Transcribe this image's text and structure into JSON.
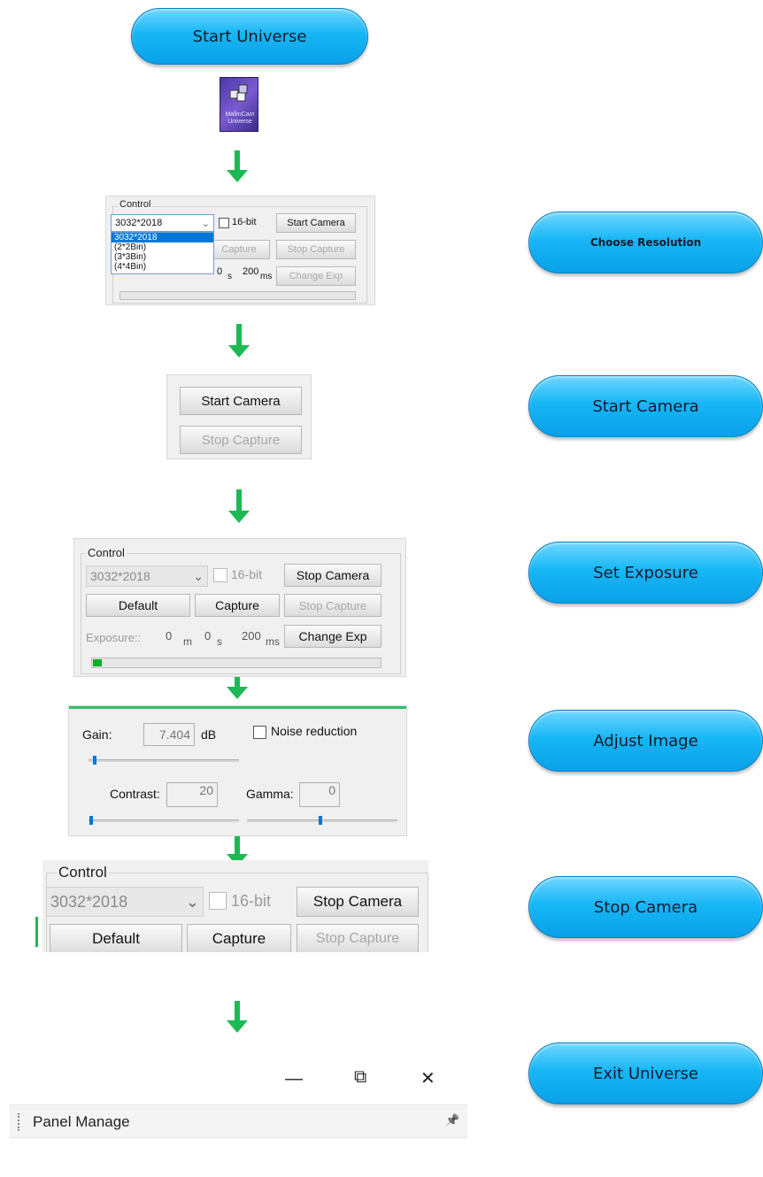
{
  "steps": {
    "start_universe": "Start Universe",
    "choose_resolution": "Choose Resolution",
    "start_camera": "Start Camera",
    "set_exposure": "Set Exposure",
    "adjust_image": "Adjust Image",
    "stop_camera": "Stop Camera",
    "exit_universe": "Exit Universe"
  },
  "app_icon": {
    "name": "mallincam-universe-icon",
    "label_line1": "MallinCam",
    "label_line2": "Universe"
  },
  "shot1": {
    "group_label": "Control",
    "resolution": "3032*2018",
    "options": [
      "3032*2018",
      "(2*2Bin)",
      "(3*3Bin)",
      "(4*4Bin)"
    ],
    "bit_label": "16-bit",
    "start_camera": "Start Camera",
    "capture": "Capture",
    "stop_capture": "Stop Capture",
    "zero": "0",
    "s_unit": "s",
    "ms_value": "200",
    "ms_unit": "ms",
    "change_exp": "Change Exp"
  },
  "shot2": {
    "start_camera": "Start Camera",
    "stop_capture": "Stop Capture"
  },
  "shot3": {
    "group_label": "Control",
    "resolution": "3032*2018",
    "bit_label": "16-bit",
    "stop_camera": "Stop Camera",
    "default": "Default",
    "capture": "Capture",
    "stop_capture": "Stop Capture",
    "exposure_label": "Exposure::",
    "min_value": "0",
    "m_unit": "m",
    "sec_value": "0",
    "s_unit": "s",
    "ms_value": "200",
    "ms_unit": "ms",
    "change_exp": "Change Exp",
    "progress": 0.03
  },
  "shot4": {
    "gain_label": "Gain:",
    "gain_value": "7.404",
    "gain_unit": "dB",
    "noise_label": "Noise reduction",
    "contrast_label": "Contrast:",
    "contrast_value": "20",
    "gamma_label": "Gamma:",
    "gamma_value": "0"
  },
  "shot5": {
    "group_label": "Control",
    "resolution": "3032*2018",
    "bit_label": "16-bit",
    "stop_camera": "Stop Camera",
    "default": "Default",
    "capture": "Capture",
    "stop_capture": "Stop Capture"
  },
  "shot6": {
    "minimize": "—",
    "restore": "⧉",
    "close": "✕",
    "panel_title": "Panel Manage",
    "pin": "📌"
  },
  "colors": {
    "arrow": "#1db954",
    "pill": "#17b7f5"
  }
}
